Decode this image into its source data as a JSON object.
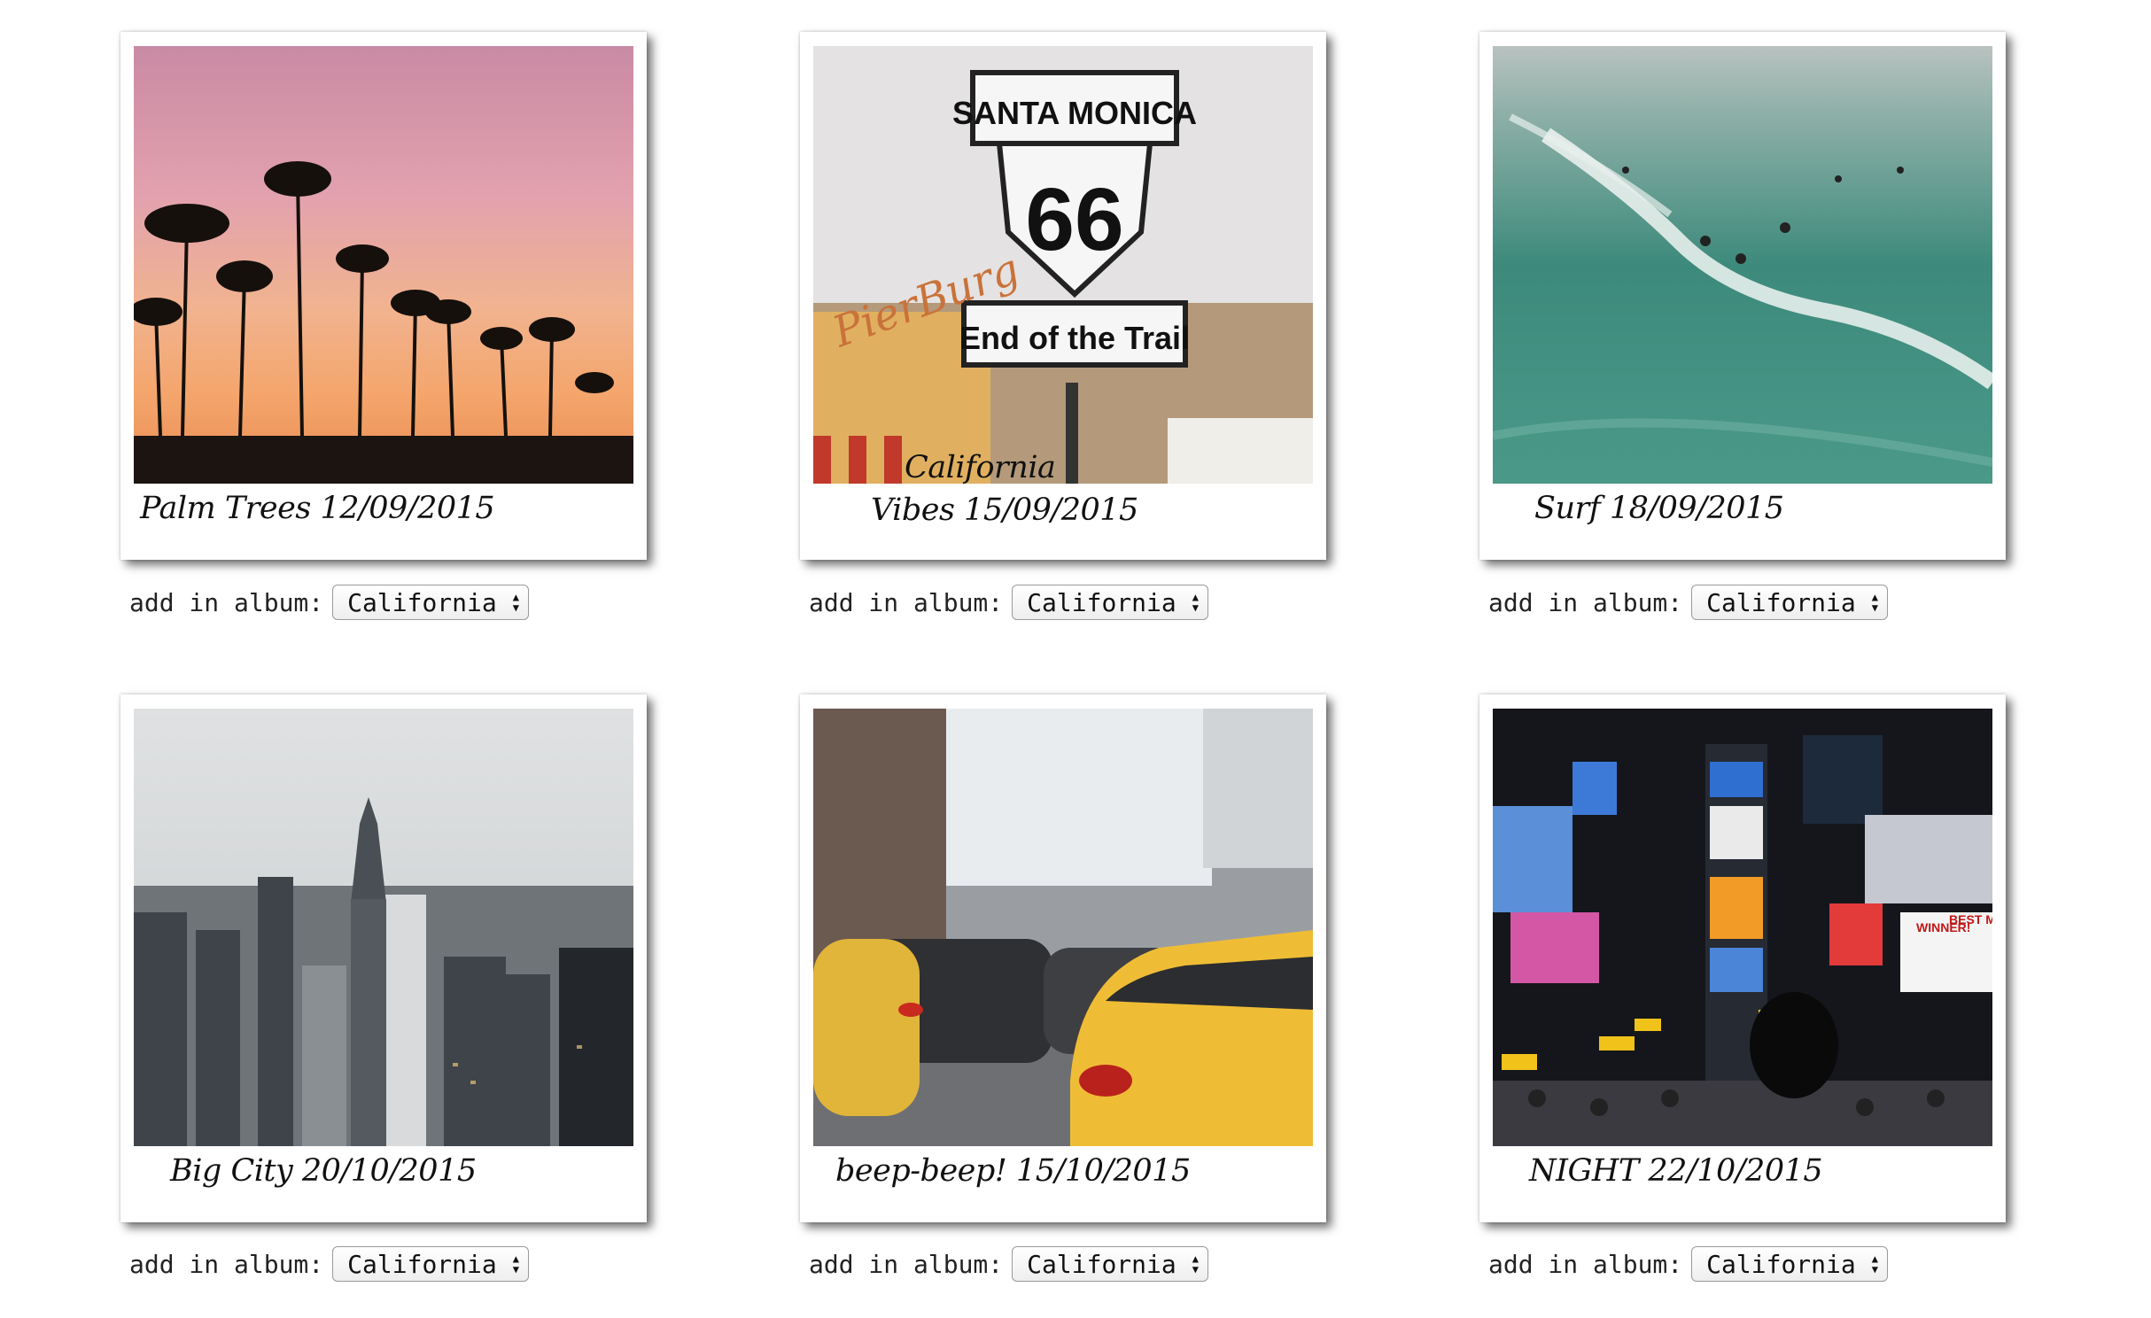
{
  "photos": [
    {
      "caption": "Palm Trees 12/09/2015",
      "album_label": "add in album:",
      "album_value": "California"
    },
    {
      "caption_line1": "California",
      "caption_line2": "Vibes 15/09/2015",
      "album_label": "add in album:",
      "album_value": "California",
      "sign_top": "SANTA MONICA",
      "sign_number": "66",
      "sign_bottom": "End of the Trail",
      "store_sign": "PierBurg"
    },
    {
      "caption": "Surf 18/09/2015",
      "album_label": "add in album:",
      "album_value": "California"
    },
    {
      "caption": "Big City 20/10/2015",
      "album_label": "add in album:",
      "album_value": "California"
    },
    {
      "caption": "beep-beep! 15/10/2015",
      "album_label": "add in album:",
      "album_value": "California"
    },
    {
      "caption": "NIGHT 22/10/2015",
      "album_label": "add in album:",
      "album_value": "California",
      "billboard_1": "WINNER!",
      "billboard_2": "BEST M"
    }
  ],
  "select_arrows": {
    "up": "▲",
    "down": "▼"
  }
}
